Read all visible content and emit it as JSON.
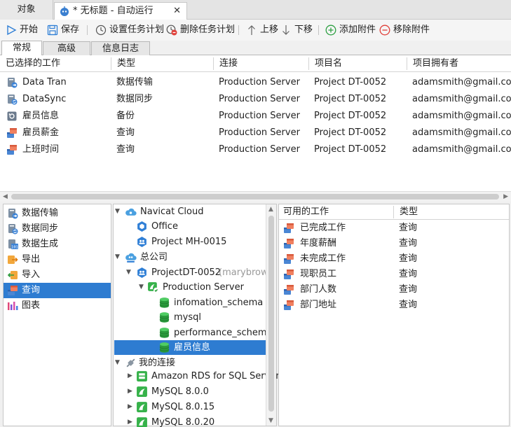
{
  "tabs": {
    "objects_label": "对象",
    "doc_label": "* 无标题 - 自动运行",
    "close_glyph": "✕"
  },
  "toolbar": {
    "start": "开始",
    "save": "保存",
    "set_schedule": "设置任务计划",
    "delete_schedule": "删除任务计划",
    "move_up": "上移",
    "move_down": "下移",
    "add_attachment": "添加附件",
    "remove_attachment": "移除附件"
  },
  "subtabs": [
    "常规",
    "高级",
    "信息日志"
  ],
  "selected_jobs": {
    "columns": [
      "已选择的工作",
      "类型",
      "连接",
      "项目名",
      "项目拥有者"
    ],
    "rows": [
      {
        "icon": "data-transfer-icon",
        "name": "Data Tran",
        "type": "数据传输",
        "conn": "Production Server",
        "project": "Project DT-0052",
        "owner": "adamsmith@gmail.com"
      },
      {
        "icon": "data-sync-icon",
        "name": "DataSync",
        "type": "数据同步",
        "conn": "Production Server",
        "project": "Project DT-0052",
        "owner": "adamsmith@gmail.com"
      },
      {
        "icon": "backup-icon",
        "name": "雇员信息",
        "type": "备份",
        "conn": "Production Server",
        "project": "Project DT-0052",
        "owner": "adamsmith@gmail.com"
      },
      {
        "icon": "query-icon",
        "name": "雇员薪金",
        "type": "查询",
        "conn": "Production Server",
        "project": "Project DT-0052",
        "owner": "adamsmith@gmail.com"
      },
      {
        "icon": "query-icon",
        "name": "上班时间",
        "type": "查询",
        "conn": "Production Server",
        "project": "Project DT-0052",
        "owner": "adamsmith@gmail.com"
      }
    ]
  },
  "job_types": [
    {
      "icon": "data-transfer-icon",
      "label": "数据传输"
    },
    {
      "icon": "data-sync-icon",
      "label": "数据同步"
    },
    {
      "icon": "data-generation-icon",
      "label": "数据生成"
    },
    {
      "icon": "export-icon",
      "label": "导出"
    },
    {
      "icon": "import-icon",
      "label": "导入"
    },
    {
      "icon": "query-icon",
      "label": "查询"
    },
    {
      "icon": "chart-icon",
      "label": "图表"
    }
  ],
  "tree": {
    "navicat_cloud": "Navicat Cloud",
    "office": "Office",
    "project_mh": "Project MH-0015",
    "company": "总公司",
    "project_dt": "ProjectDT-0052",
    "project_dt_owner": "(marybrown",
    "production_server": "Production Server",
    "db1": "infomation_schema",
    "db2": "mysql",
    "db3": "performance_schema",
    "db4": "雇员信息",
    "my_connections": "我的连接",
    "conn1": "Amazon RDS for SQL Server",
    "conn2": "MySQL 8.0.0",
    "conn3": "MySQL 8.0.15",
    "conn4": "MySQL 8.0.20"
  },
  "available_jobs": {
    "columns": [
      "可用的工作",
      "类型"
    ],
    "rows": [
      {
        "name": "已完成工作",
        "type": "查询"
      },
      {
        "name": "年度薪酬",
        "type": "查询"
      },
      {
        "name": "未完成工作",
        "type": "查询"
      },
      {
        "name": "现职员工",
        "type": "查询"
      },
      {
        "name": "部门人数",
        "type": "查询"
      },
      {
        "name": "部门地址",
        "type": "查询"
      }
    ]
  }
}
